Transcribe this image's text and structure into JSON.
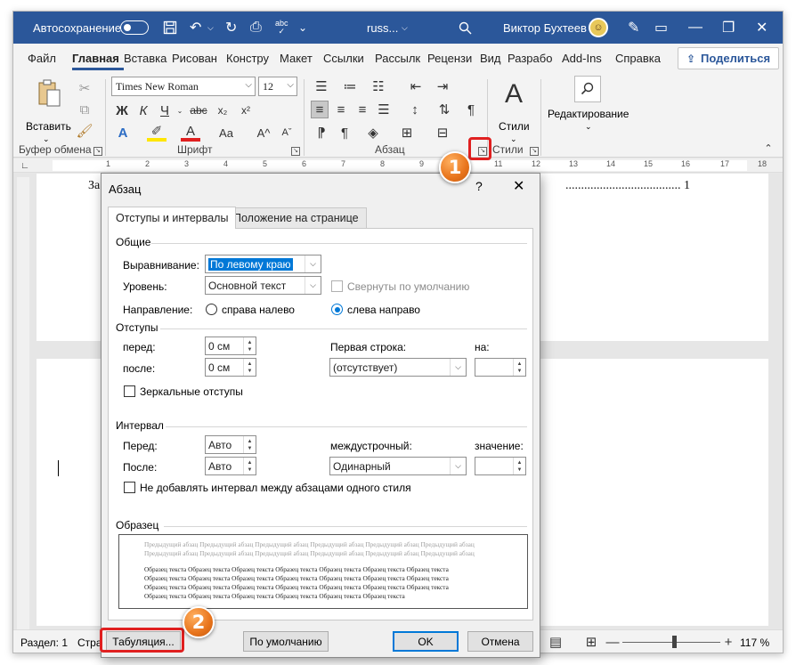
{
  "titlebar": {
    "autosave_label": "Автосохранение",
    "doc_name": "russ...",
    "user_name": "Виктор Бухтеев"
  },
  "tabs": [
    {
      "label": "Файл"
    },
    {
      "label": "Главная"
    },
    {
      "label": "Вставка"
    },
    {
      "label": "Рисован"
    },
    {
      "label": "Констру"
    },
    {
      "label": "Макет"
    },
    {
      "label": "Ссылки"
    },
    {
      "label": "Рассылк"
    },
    {
      "label": "Рецензи"
    },
    {
      "label": "Вид"
    },
    {
      "label": "Разрабо"
    },
    {
      "label": "Add-Ins"
    },
    {
      "label": "Справка"
    }
  ],
  "share_label": "Поделиться",
  "ribbon": {
    "paste_label": "Вставить",
    "font_name": "Times New Roman",
    "font_size": "12",
    "styles_label": "Стили",
    "editing_label": "Редактирование",
    "groups": {
      "clipboard": "Буфер обмена",
      "font": "Шрифт",
      "paragraph": "Абзац",
      "styles": "Стили"
    }
  },
  "ruler_numbers": [
    "1",
    "2",
    "3",
    "4",
    "5",
    "6",
    "7",
    "8",
    "9",
    "10",
    "11",
    "12",
    "13",
    "14",
    "15",
    "16",
    "17",
    "18"
  ],
  "document": {
    "text_left": "За",
    "text_right": "..................................... 1"
  },
  "statusbar": {
    "section": "Раздел: 1",
    "page": "Стра",
    "zoom": "117 %"
  },
  "dialog": {
    "title": "Абзац",
    "help": "?",
    "close": "✕",
    "tabs": [
      "Отступы и интервалы",
      "Положение на странице"
    ],
    "general": {
      "heading": "Общие",
      "alignment_label": "Выравнивание:",
      "alignment_value": "По левому краю",
      "level_label": "Уровень:",
      "level_value": "Основной текст",
      "collapsed_label": "Свернуты по умолчанию",
      "direction_label": "Направление:",
      "rtl_label": "справа налево",
      "ltr_label": "слева направо"
    },
    "indents": {
      "heading": "Отступы",
      "before_label": "перед:",
      "before_value": "0 см",
      "after_label": "после:",
      "after_value": "0 см",
      "first_line_label": "Первая строка:",
      "first_line_value": "(отсутствует)",
      "by_label": "на:",
      "mirror_label": "Зеркальные отступы"
    },
    "spacing": {
      "heading": "Интервал",
      "before_label": "Перед:",
      "before_value": "Авто",
      "after_label": "После:",
      "after_value": "Авто",
      "line_label": "междустрочный:",
      "line_value": "Одинарный",
      "at_label": "значение:",
      "dont_add_label": "Не добавлять интервал между абзацами одного стиля"
    },
    "preview": {
      "heading": "Образец",
      "prev_lines": [
        "Предыдущий абзац Предыдущий абзац Предыдущий абзац Предыдущий абзац Предыдущий абзац Предыдущий абзац",
        "Предыдущий абзац Предыдущий абзац Предыдущий абзац Предыдущий абзац Предыдущий абзац Предыдущий абзац"
      ],
      "sample_lines": [
        "Образец текста Образец текста Образец текста Образец текста Образец текста Образец текста Образец текста",
        "Образец текста Образец текста Образец текста Образец текста Образец текста Образец текста Образец текста",
        "Образец текста Образец текста Образец текста Образец текста Образец текста Образец текста Образец текста",
        "Образец текста Образец текста Образец текста Образец текста Образец текста Образец текста"
      ]
    },
    "buttons": {
      "tabs": "Табуляция...",
      "default": "По умолчанию",
      "ok": "OK",
      "cancel": "Отмена"
    }
  },
  "callouts": {
    "one": "1",
    "two": "2"
  },
  "colors": {
    "title_bar": "#2b579a",
    "accent": "#0078d7",
    "callout": "#e8741c",
    "highlight_box": "#e02020"
  }
}
